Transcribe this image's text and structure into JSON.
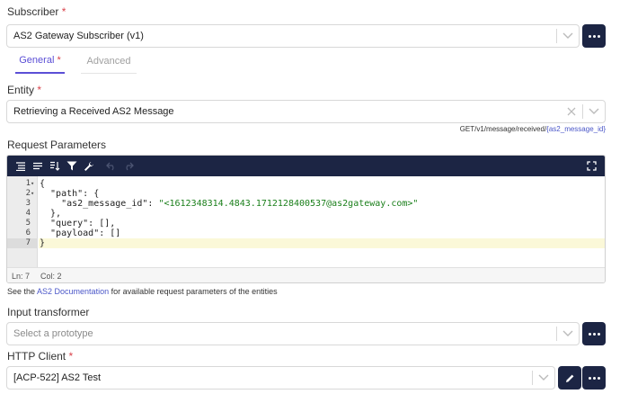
{
  "subscriber": {
    "label": "Subscriber",
    "required_mark": "*",
    "value": "AS2 Gateway Subscriber (v1)"
  },
  "tabs": [
    {
      "label": "General",
      "required_mark": "*",
      "active": true
    },
    {
      "label": "Advanced",
      "active": false
    }
  ],
  "entity": {
    "label": "Entity",
    "required_mark": "*",
    "value": "Retrieving a Received AS2 Message",
    "endpoint_prefix": "GET/v1/message/received/",
    "endpoint_param": "{as2_message_id}"
  },
  "request_params": {
    "label": "Request Parameters",
    "lines": [
      {
        "num": "1",
        "fold": "▾",
        "text": "{"
      },
      {
        "num": "2",
        "fold": "▾",
        "text": "  \"path\": {"
      },
      {
        "num": "3",
        "fold": "",
        "key": "    \"as2_message_id\": ",
        "str": "\"<1612348314.4843.1712128400537@as2gateway.com>\""
      },
      {
        "num": "4",
        "fold": "",
        "text": "  },"
      },
      {
        "num": "5",
        "fold": "",
        "text": "  \"query\": [],"
      },
      {
        "num": "6",
        "fold": "",
        "text": "  \"payload\": []"
      },
      {
        "num": "7",
        "fold": "",
        "text": "}"
      }
    ],
    "status_line": "Ln: 7",
    "status_col": "Col: 2",
    "help_prefix": "See the ",
    "help_link": "AS2 Documentation",
    "help_suffix": " for available request parameters of the entities"
  },
  "input_transformer": {
    "label": "Input transformer",
    "placeholder": "Select a prototype"
  },
  "http_client": {
    "label": "HTTP Client",
    "required_mark": "*",
    "value": "[ACP-522] AS2 Test"
  },
  "colors": {
    "dark_button": "#1c2544",
    "accent": "#5b4fd6",
    "required": "#d9434c",
    "link": "#4a56c8"
  },
  "icons": {
    "toolbar": [
      "format-icon",
      "compact-icon",
      "sort-icon",
      "filter-icon",
      "wrench-icon",
      "undo-icon",
      "redo-icon",
      "fullscreen-icon"
    ]
  }
}
